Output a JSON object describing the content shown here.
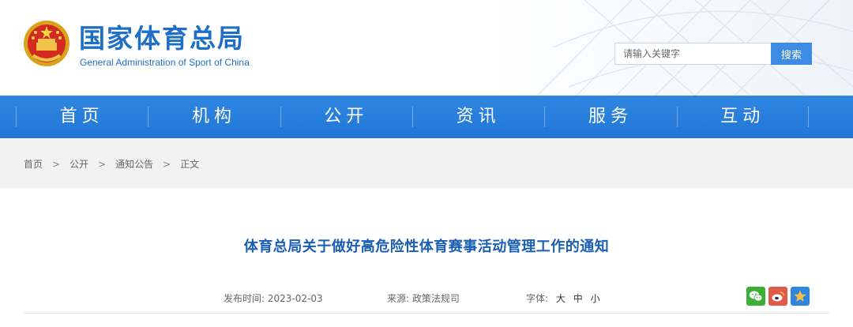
{
  "header": {
    "brand_cn": "国家体育总局",
    "brand_en": "General Administration of Sport of China",
    "emblem_icon": "national-emblem-icon"
  },
  "search": {
    "placeholder": "请输入关键字",
    "button_label": "搜索"
  },
  "nav": {
    "items": [
      {
        "label": "首页"
      },
      {
        "label": "机构"
      },
      {
        "label": "公开"
      },
      {
        "label": "资讯"
      },
      {
        "label": "服务"
      },
      {
        "label": "互动"
      }
    ]
  },
  "breadcrumb": {
    "items": [
      {
        "label": "首页"
      },
      {
        "label": "公开"
      },
      {
        "label": "通知公告"
      },
      {
        "label": "正文"
      }
    ],
    "separator": ">"
  },
  "article": {
    "title": "体育总局关于做好高危险性体育赛事活动管理工作的通知",
    "date_label": "发布时间:",
    "date_value": "2023-02-03",
    "source_label": "来源:",
    "source_value": "政策法规司",
    "font_label": "字体:",
    "font_sizes": [
      "大",
      "中",
      "小"
    ]
  },
  "share": {
    "icons": [
      "wechat-icon",
      "weibo-icon",
      "favorite-icon"
    ]
  },
  "colors": {
    "brand_blue": "#1f6fc7",
    "nav_blue": "#2277d6",
    "title_blue": "#1a5fb4",
    "crumb_band": "#f2f2f2"
  }
}
